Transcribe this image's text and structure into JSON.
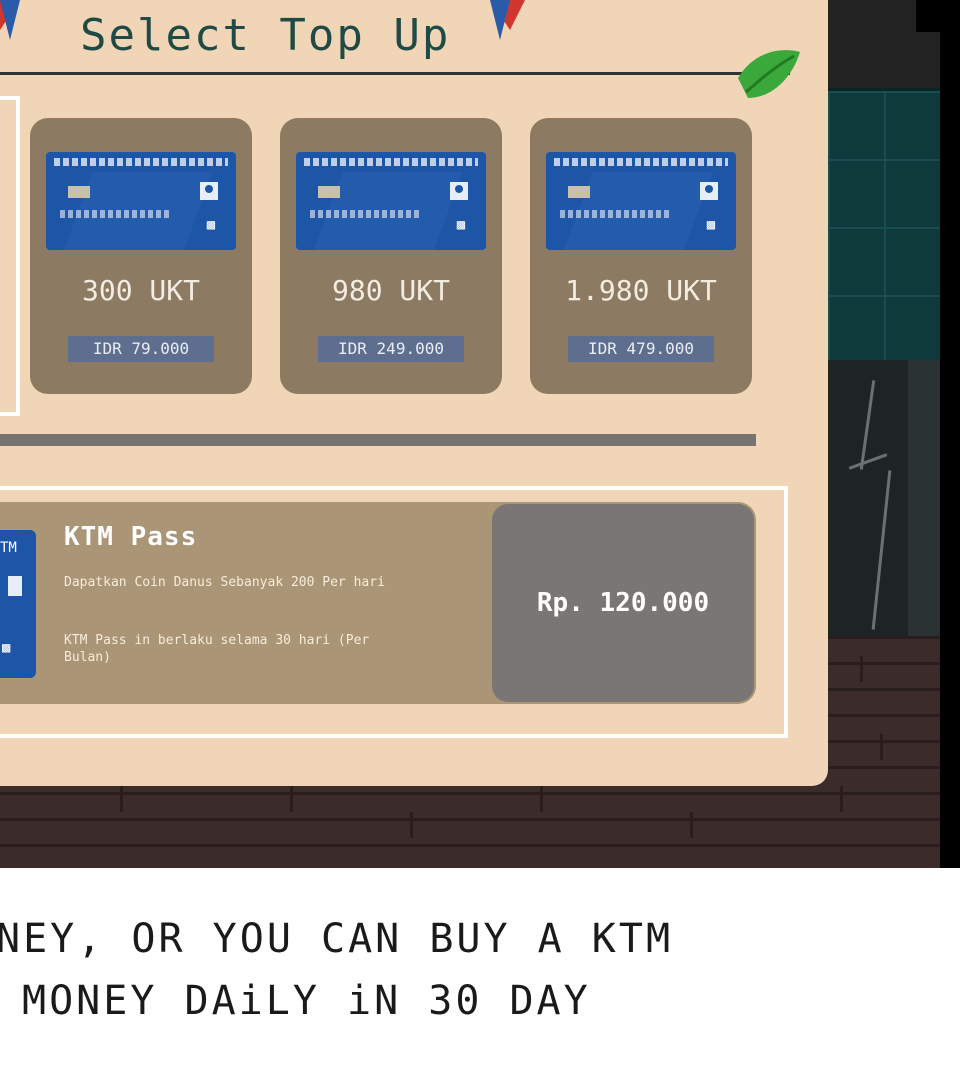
{
  "panel": {
    "title": "Select Top Up"
  },
  "topups": [
    {
      "amount": "300 UKT",
      "price": "IDR 79.000"
    },
    {
      "amount": "980 UKT",
      "price": "IDR 249.000"
    },
    {
      "amount": "1.980 UKT",
      "price": "IDR 479.000"
    }
  ],
  "pass": {
    "card_label": "TM",
    "title": "KTM Pass",
    "desc_1": "Dapatkan Coin Danus Sebanyak 200 Per hari",
    "desc_2": "KTM Pass in berlaku selama 30 hari (Per Bulan)",
    "price": "Rp. 120.000"
  },
  "caption": {
    "line_1": "NEY, OR YOU CAN BUY A KTM",
    "line_2": "MONEY DAiLY iN 30 DAY"
  },
  "colors": {
    "panel_bg": "#f0d6b6",
    "card_bg": "#8c7a63",
    "bank_card": "#1e56a7",
    "title_text": "#1f4a45"
  }
}
